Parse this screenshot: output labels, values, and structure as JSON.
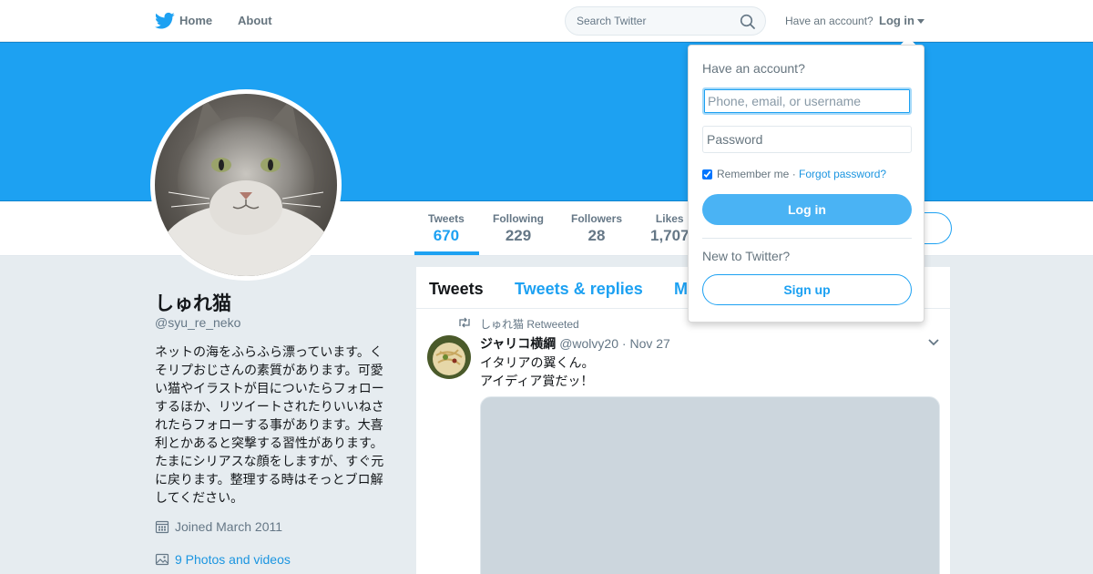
{
  "colors": {
    "brand": "#1da1f2",
    "link": "#1b95e0",
    "muted": "#657786",
    "banner": "#1da1f2"
  },
  "nav": {
    "logo_icon": "twitter-bird-icon",
    "home": "Home",
    "about": "About",
    "search_placeholder": "Search Twitter",
    "have_account": "Have an account?",
    "login": "Log in"
  },
  "stats": [
    {
      "label": "Tweets",
      "value": "670"
    },
    {
      "label": "Following",
      "value": "229"
    },
    {
      "label": "Followers",
      "value": "28"
    },
    {
      "label": "Likes",
      "value": "1,707"
    }
  ],
  "profile": {
    "name": "しゅれ猫",
    "handle": "@syu_re_neko",
    "bio": "ネットの海をふらふら漂っています。くそリプおじさんの素質があります。可愛い猫やイラストが目についたらフォローするほか、リツイートされたりいいねされたらフォローする事があります。大喜利とかあると突撃する習性があります。たまにシリアスな顔をしますが、すぐ元に戻ります。整理する時はそっとブロ解してください。",
    "joined": "Joined March 2011",
    "photos": "9 Photos and videos"
  },
  "timeline": {
    "tabs": [
      "Tweets",
      "Tweets & replies",
      "M"
    ],
    "tweet": {
      "retweet_label": "しゅれ猫 Retweeted",
      "author_name": "ジャリコ横綱",
      "author_handle": "@wolvy20",
      "separator": "·",
      "date": "Nov 27",
      "text_line1": "イタリアの翼くん。",
      "text_line2": "アイディア賞だッ！"
    }
  },
  "login_dropdown": {
    "title": "Have an account?",
    "username_placeholder": "Phone, email, or username",
    "password_placeholder": "Password",
    "remember": "Remember me",
    "separator": "·",
    "forgot": "Forgot password?",
    "login_button": "Log in",
    "new_to_twitter": "New to Twitter?",
    "signup_button": "Sign up"
  }
}
